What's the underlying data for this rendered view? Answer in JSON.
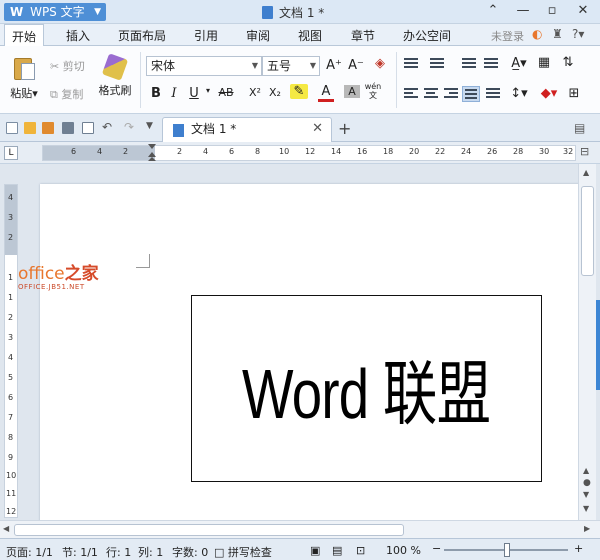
{
  "titlebar": {
    "app_name": "WPS 文字",
    "app_mark": "W",
    "document_title": "文档 1 *"
  },
  "tabs": [
    "开始",
    "插入",
    "页面布局",
    "引用",
    "审阅",
    "视图",
    "章节",
    "办公空间"
  ],
  "active_tab": "开始",
  "account": {
    "login_label": "未登录"
  },
  "clipboard": {
    "paste_label": "粘贴",
    "cut_label": "剪切",
    "copy_label": "复制",
    "format_painter_label": "格式刷"
  },
  "font": {
    "family": "宋体",
    "size": "五号",
    "bold": "B",
    "italic": "I",
    "underline": "U",
    "strikethrough": "AB",
    "superscript": "X²",
    "subscript": "X₂",
    "font_color": "A",
    "char_shading": "A",
    "phonetic": "wén 文",
    "grow": "A⁺",
    "shrink": "A⁻"
  },
  "quickbar": {
    "doc_tab_title": "文档 1 *",
    "add_tab": "+"
  },
  "ruler": {
    "corner": "L",
    "h_labels": [
      "6",
      "4",
      "2",
      "2",
      "4",
      "6",
      "8",
      "10",
      "12",
      "14",
      "16",
      "18",
      "20",
      "22",
      "24",
      "26",
      "28",
      "30",
      "32"
    ],
    "v_labels": [
      "4",
      "3",
      "2",
      "1",
      "1",
      "2",
      "3",
      "4",
      "5",
      "6",
      "7",
      "8",
      "9",
      "10",
      "11",
      "12"
    ]
  },
  "document": {
    "textbox_text": "Word 联盟"
  },
  "watermark": {
    "main_a": "office",
    "main_b": "之家",
    "sub": "OFFICE.JB51.NET"
  },
  "statusbar": {
    "page": "页面: 1/1",
    "section": "节: 1/1",
    "line": "行: 1",
    "column": "列: 1",
    "word_count": "字数: 0",
    "spell_check": "拼写检查",
    "zoom": "100 %"
  },
  "colors": {
    "accent": "#4e8fd6",
    "watermark_orange": "#e8772e",
    "watermark_red": "#cc4b2a"
  }
}
